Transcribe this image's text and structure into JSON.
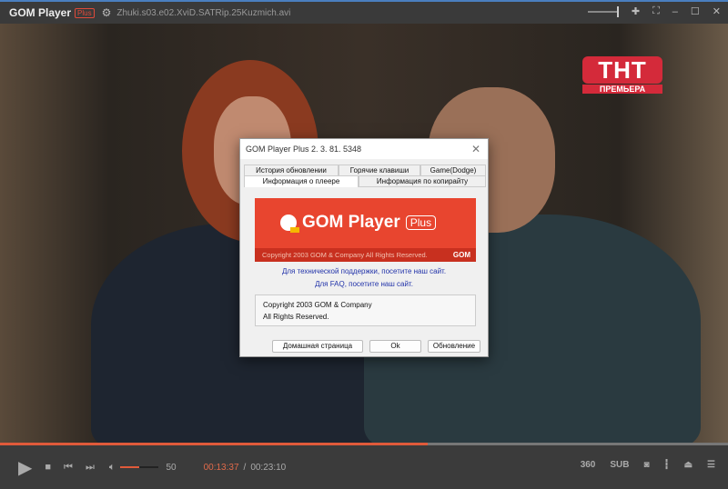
{
  "titlebar": {
    "app": "GOM Player",
    "badge": "Plus",
    "filename": "Zhuki.s03.e02.XviD.SATRip.25Kuzmich.avi"
  },
  "overlay": {
    "channel": "ТНТ",
    "channel_sub": "ПРЕМЬЕРА"
  },
  "playback": {
    "progress_percent": 58.7,
    "volume": "50",
    "volume_percent": 50,
    "current_time": "00:13:37",
    "separator": "/",
    "total_time": "00:23:10"
  },
  "controls_right": {
    "vr": "360",
    "sub": "SUB"
  },
  "dialog": {
    "title": "GOM Player Plus 2. 3. 81. 5348",
    "tabs_row1": [
      "История обновлении",
      "Горячие клавиши",
      "Game(Dodge)"
    ],
    "tabs_row2": [
      "Информация о плеере",
      "Информация по копирайту"
    ],
    "banner_title": "GOM Player",
    "banner_plus": "Plus",
    "banner_copyright": "Copyright 2003 GOM & Company All Rights Reserved.",
    "banner_gom": "GOM",
    "link_support": "Для технической поддержки, посетите наш сайт.",
    "link_faq": "Для FAQ, посетите наш сайт.",
    "copyright_line1": "Copyright 2003 GOM & Company",
    "copyright_line2": "All Rights Reserved.",
    "btn_home": "Домашная страница",
    "btn_ok": "Ok",
    "btn_update": "Обновление"
  },
  "colors": {
    "accent": "#e05a3a",
    "banner": "#e8452f"
  }
}
